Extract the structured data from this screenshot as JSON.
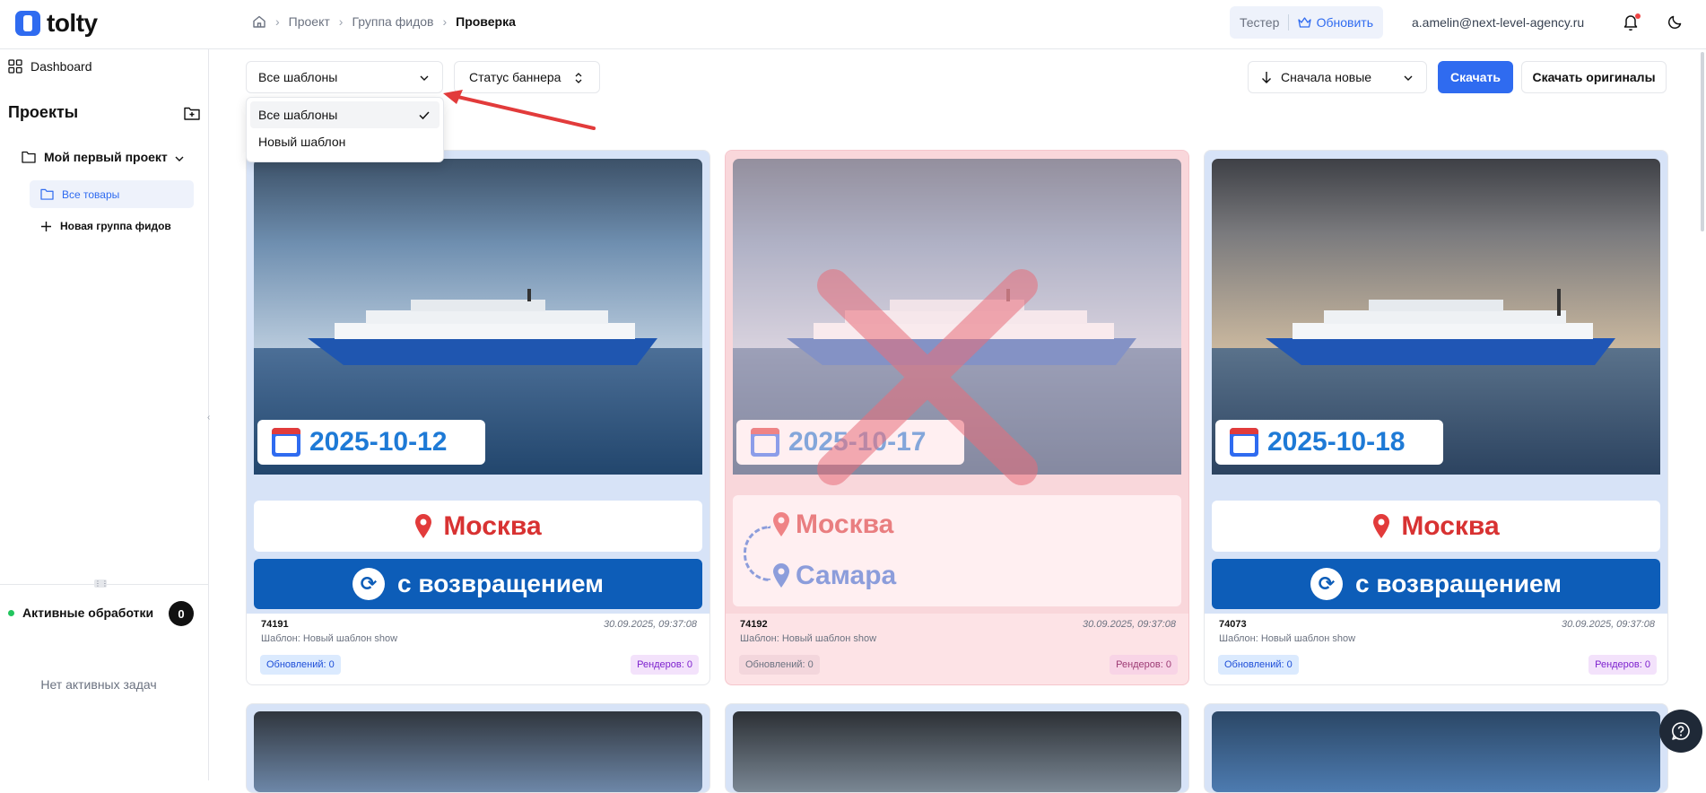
{
  "app": {
    "name": "tolty"
  },
  "breadcrumbs": [
    "Проект",
    "Группа фидов",
    "Проверка"
  ],
  "header": {
    "plan_label": "Тестер",
    "upgrade_label": "Обновить",
    "email": "a.amelin@next-level-agency.ru"
  },
  "sidebar": {
    "dashboard_label": "Dashboard",
    "projects_title": "Проекты",
    "project_name": "Мой первый проект",
    "items": [
      {
        "label": "Все товары"
      },
      {
        "label": "Новая группа фидов"
      }
    ],
    "active_tasks_label": "Активные обработки",
    "active_tasks_count": "0",
    "no_tasks_text": "Нет активных задач"
  },
  "toolbar": {
    "template_select": "Все шаблоны",
    "status_select": "Статус баннера",
    "sort_select": "Сначала новые",
    "download_label": "Скачать",
    "download_originals_label": "Скачать оригиналы"
  },
  "dropdown": {
    "options": [
      {
        "label": "Все шаблоны",
        "selected": true
      },
      {
        "label": "Новый шаблон",
        "selected": false
      }
    ]
  },
  "cards": [
    {
      "id": "74191",
      "date": "30.09.2025, 09:37:08",
      "template": "Шаблон: Новый шаблон show",
      "updates": "Обновлений: 0",
      "renders": "Рендеров: 0",
      "banner_date": "2025-10-12",
      "city": "Москва",
      "return_label": "с возвращением",
      "rejected": false
    },
    {
      "id": "74192",
      "date": "30.09.2025, 09:37:08",
      "template": "Шаблон: Новый шаблон show",
      "updates": "Обновлений: 0",
      "renders": "Рендеров: 0",
      "banner_date": "2025-10-17",
      "city_from": "Москва",
      "city_to": "Самара",
      "rejected": true
    },
    {
      "id": "74073",
      "date": "30.09.2025, 09:37:08",
      "template": "Шаблон: Новый шаблон show",
      "updates": "Обновлений: 0",
      "renders": "Рендеров: 0",
      "banner_date": "2025-10-18",
      "city": "Москва",
      "return_label": "с возвращением",
      "rejected": false
    }
  ],
  "colors": {
    "accent": "#2f6bf0",
    "reject": "#e23b3b",
    "banner_blue": "#0d5db8"
  }
}
